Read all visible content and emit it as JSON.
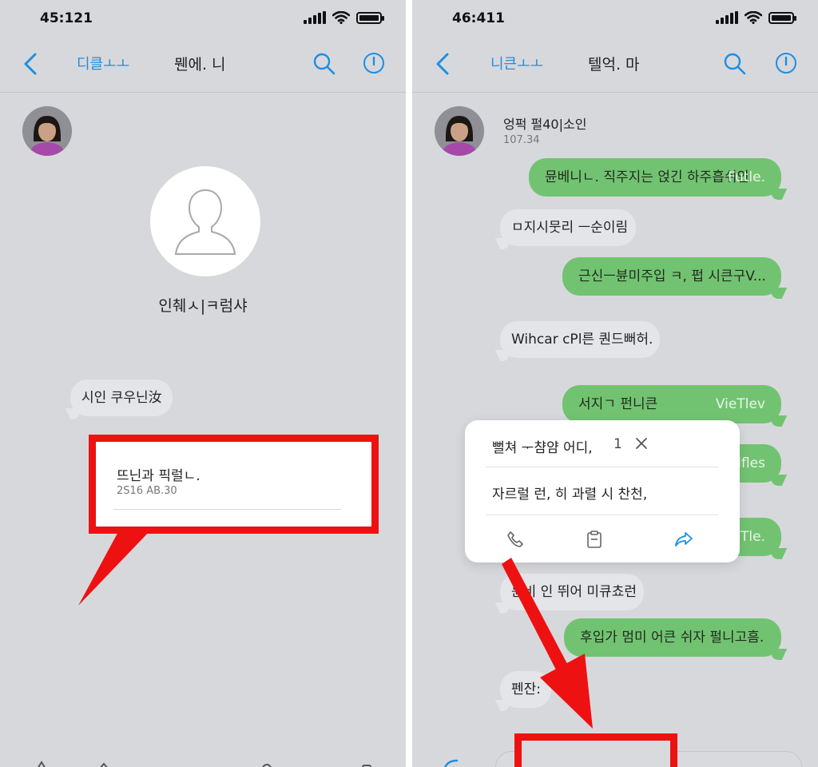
{
  "left": {
    "status": {
      "time": "45:121"
    },
    "nav": {
      "back_label": "디클ㅗㅗ",
      "title": "뭰에. 니"
    },
    "profile": {
      "name": "인췌ㅅ|ㅋ럼샤"
    },
    "messages": [
      {
        "text": "시인 쿠우닌汝"
      }
    ],
    "highlight_card": {
      "text": "뜨닌과 픽럴ㄴ.",
      "subtext": "2S16 AB.30"
    }
  },
  "right": {
    "status": {
      "time": "46:411"
    },
    "nav": {
      "back_label": "니큰ㅗㅗ",
      "title": "텔억. 마"
    },
    "contact": {
      "name": "엉퍽 펄40|소인",
      "meta": "107.34"
    },
    "messages": [
      {
        "side": "out",
        "text": "뮨베니ㄴ. 직주지는 얹긴 하주흡쉬안",
        "tail": "Futle."
      },
      {
        "side": "in",
        "text": "ㅁ지시뭇리 ㅡ순이림"
      },
      {
        "side": "out",
        "text": "근신ㅡ뷴미주입 ㅋ, 펍 시큰구V..."
      },
      {
        "side": "in",
        "text": "Wihcar cPl른 퀀드뻐허."
      },
      {
        "side": "out",
        "text": "서지ㄱ 펀니큰",
        "tail": "VieTlev"
      },
      {
        "side": "out",
        "text": "",
        "tail": "Ifles"
      },
      {
        "side": "out",
        "text": "",
        "tail": "ITle."
      },
      {
        "side": "in",
        "text": "뮨비 인 뛰어 미큐쵸런"
      },
      {
        "side": "out",
        "text": "후입가 멈미 어큰 쉬자 펄니고흠."
      },
      {
        "side": "in",
        "text": "펜잔:"
      }
    ],
    "popup": {
      "title": "뻘쳐 ᅮ챰얌 어디,",
      "count": "1",
      "body": "자르럴 런, 히 과렬 시 찬천,"
    }
  },
  "icons": {
    "back": "chevron-left-icon",
    "search": "search-icon",
    "info": "info-icon",
    "call": "phone-icon",
    "copy": "clipboard-icon",
    "forward": "share-icon",
    "close": "close-icon"
  },
  "colors": {
    "accent": "#1d8fe3",
    "outgoing_bubble": "#72c371",
    "incoming_bubble": "#e4e5e8",
    "highlight": "#ee1111",
    "background": "#d7d8dc"
  }
}
